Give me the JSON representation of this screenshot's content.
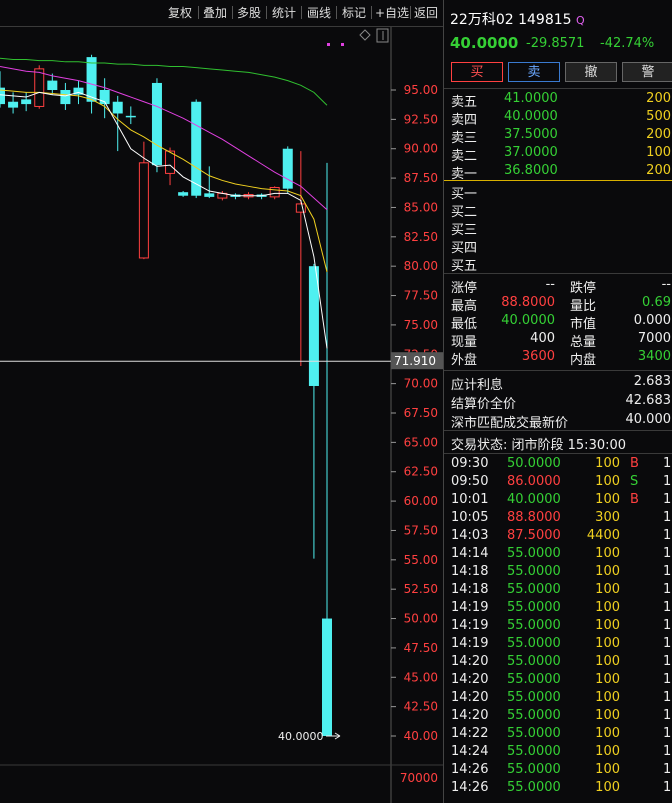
{
  "toolbar": {
    "items": [
      "复权",
      "叠加",
      "多股",
      "统计",
      "画线",
      "标记",
      "+自选",
      "返回"
    ]
  },
  "chart": {
    "y_ticks": [
      "95.00",
      "92.50",
      "90.00",
      "87.50",
      "85.00",
      "82.50",
      "80.00",
      "77.50",
      "75.00",
      "72.50",
      "70.00",
      "67.50",
      "65.00",
      "62.50",
      "60.00",
      "57.50",
      "55.00",
      "52.50",
      "50.00",
      "47.50",
      "45.00",
      "42.50",
      "40.00"
    ],
    "y_values": [
      95,
      92.5,
      90,
      87.5,
      85,
      82.5,
      80,
      77.5,
      75,
      72.5,
      70,
      67.5,
      65,
      62.5,
      60,
      57.5,
      55,
      52.5,
      50,
      47.5,
      45,
      42.5,
      40
    ],
    "crosshair_label": "71.910",
    "crosshair_value": 71.91,
    "low_marker_label": "40.0000",
    "volume_label": "70000",
    "colors": {
      "up": "#ff4040",
      "down": "#4ff0f0",
      "ma5": "#ffffff",
      "ma10": "#f0d020",
      "ma20": "#e040e0",
      "ma60": "#30c030"
    }
  },
  "quote": {
    "name": "22万科02",
    "code": "149815",
    "q_icon": "Q",
    "last": "40.0000",
    "change": "-29.8571",
    "change_pct": "-42.74%",
    "buttons": [
      "买",
      "卖",
      "撤",
      "警"
    ]
  },
  "sell_book": [
    {
      "label": "卖五",
      "price": "41.0000",
      "vol": "200"
    },
    {
      "label": "卖四",
      "price": "40.0000",
      "vol": "500"
    },
    {
      "label": "卖三",
      "price": "37.5000",
      "vol": "200"
    },
    {
      "label": "卖二",
      "price": "37.0000",
      "vol": "100"
    },
    {
      "label": "卖一",
      "price": "36.8000",
      "vol": "200"
    }
  ],
  "buy_book": [
    {
      "label": "买一"
    },
    {
      "label": "买二"
    },
    {
      "label": "买三"
    },
    {
      "label": "买四"
    },
    {
      "label": "买五"
    }
  ],
  "stats": [
    {
      "l1": "涨停",
      "v1": "--",
      "c1": "white",
      "l2": "跌停",
      "v2": "--",
      "c2": "white"
    },
    {
      "l1": "最高",
      "v1": "88.8000",
      "c1": "red",
      "l2": "量比",
      "v2": "0.69",
      "c2": "green"
    },
    {
      "l1": "最低",
      "v1": "40.0000",
      "c1": "green",
      "l2": "市值",
      "v2": "0.000",
      "c2": "white"
    },
    {
      "l1": "现量",
      "v1": "400",
      "c1": "white",
      "l2": "总量",
      "v2": "7000",
      "c2": "white"
    },
    {
      "l1": "外盘",
      "v1": "3600",
      "c1": "red",
      "l2": "内盘",
      "v2": "3400",
      "c2": "green"
    }
  ],
  "extra": [
    {
      "label": "应计利息",
      "value": "2.683"
    },
    {
      "label": "结算价全价",
      "value": "42.683"
    },
    {
      "label": "深市匹配成交最新价",
      "value": "40.000"
    }
  ],
  "trade_status": "交易状态: 闭市阶段 15:30:00",
  "ticks": [
    {
      "time": "09:30",
      "price": "50.0000",
      "pc": "green",
      "vol": "100",
      "flag": "B",
      "n": "1"
    },
    {
      "time": "09:50",
      "price": "86.0000",
      "pc": "red",
      "vol": "100",
      "flag": "S",
      "n": "1"
    },
    {
      "time": "10:01",
      "price": "40.0000",
      "pc": "green",
      "vol": "100",
      "flag": "B",
      "n": "1"
    },
    {
      "time": "10:05",
      "price": "88.8000",
      "pc": "red",
      "vol": "300",
      "flag": "",
      "n": "1"
    },
    {
      "time": "14:03",
      "price": "87.5000",
      "pc": "red",
      "vol": "4400",
      "flag": "",
      "n": "1"
    },
    {
      "time": "14:14",
      "price": "55.0000",
      "pc": "green",
      "vol": "100",
      "flag": "",
      "n": "1"
    },
    {
      "time": "14:18",
      "price": "55.0000",
      "pc": "green",
      "vol": "100",
      "flag": "",
      "n": "1"
    },
    {
      "time": "14:18",
      "price": "55.0000",
      "pc": "green",
      "vol": "100",
      "flag": "",
      "n": "1"
    },
    {
      "time": "14:19",
      "price": "55.0000",
      "pc": "green",
      "vol": "100",
      "flag": "",
      "n": "1"
    },
    {
      "time": "14:19",
      "price": "55.0000",
      "pc": "green",
      "vol": "100",
      "flag": "",
      "n": "1"
    },
    {
      "time": "14:19",
      "price": "55.0000",
      "pc": "green",
      "vol": "100",
      "flag": "",
      "n": "1"
    },
    {
      "time": "14:20",
      "price": "55.0000",
      "pc": "green",
      "vol": "100",
      "flag": "",
      "n": "1"
    },
    {
      "time": "14:20",
      "price": "55.0000",
      "pc": "green",
      "vol": "100",
      "flag": "",
      "n": "1"
    },
    {
      "time": "14:20",
      "price": "55.0000",
      "pc": "green",
      "vol": "100",
      "flag": "",
      "n": "1"
    },
    {
      "time": "14:20",
      "price": "55.0000",
      "pc": "green",
      "vol": "100",
      "flag": "",
      "n": "1"
    },
    {
      "time": "14:22",
      "price": "55.0000",
      "pc": "green",
      "vol": "100",
      "flag": "",
      "n": "1"
    },
    {
      "time": "14:24",
      "price": "55.0000",
      "pc": "green",
      "vol": "100",
      "flag": "",
      "n": "1"
    },
    {
      "time": "14:26",
      "price": "55.0000",
      "pc": "green",
      "vol": "100",
      "flag": "",
      "n": "1"
    },
    {
      "time": "14:26",
      "price": "55.0000",
      "pc": "green",
      "vol": "100",
      "flag": "",
      "n": "1"
    }
  ],
  "chart_data": {
    "type": "candlestick",
    "title": "",
    "ylim": [
      38,
      99
    ],
    "y_ticks": [
      95,
      92.5,
      90,
      87.5,
      85,
      82.5,
      80,
      77.5,
      75,
      72.5,
      70,
      67.5,
      65,
      62.5,
      60,
      57.5,
      55,
      52.5,
      50,
      47.5,
      45,
      42.5,
      40
    ],
    "candles": [
      {
        "open": 95.2,
        "close": 93.8,
        "high": 96.6,
        "low": 93.5
      },
      {
        "open": 94.0,
        "close": 93.5,
        "high": 94.8,
        "low": 93.0
      },
      {
        "open": 94.2,
        "close": 93.8,
        "high": 94.8,
        "low": 93.2
      },
      {
        "open": 93.6,
        "close": 96.8,
        "high": 97.1,
        "low": 93.4
      },
      {
        "open": 95.8,
        "close": 95.0,
        "high": 96.4,
        "low": 94.6
      },
      {
        "open": 95.0,
        "close": 93.8,
        "high": 95.6,
        "low": 93.3
      },
      {
        "open": 95.2,
        "close": 94.6,
        "high": 95.8,
        "low": 93.8
      },
      {
        "open": 97.8,
        "close": 94.0,
        "high": 98.0,
        "low": 93.0
      },
      {
        "open": 95.0,
        "close": 93.8,
        "high": 96.0,
        "low": 92.6
      },
      {
        "open": 94.0,
        "close": 93.0,
        "high": 94.5,
        "low": 89.8
      },
      {
        "open": 92.8,
        "close": 92.7,
        "high": 93.6,
        "low": 92.1
      },
      {
        "open": 80.7,
        "close": 88.8,
        "high": 90.6,
        "low": 80.6
      },
      {
        "open": 95.6,
        "close": 88.6,
        "high": 96.0,
        "low": 88.0
      },
      {
        "open": 87.9,
        "close": 89.8,
        "high": 90.1,
        "low": 86.9
      },
      {
        "open": 86.3,
        "close": 86.0,
        "high": 86.4,
        "low": 85.9
      },
      {
        "open": 94.0,
        "close": 86.0,
        "high": 94.2,
        "low": 85.8
      },
      {
        "open": 86.2,
        "close": 85.9,
        "high": 88.5,
        "low": 85.8
      },
      {
        "open": 85.8,
        "close": 86.2,
        "high": 86.4,
        "low": 85.6
      },
      {
        "open": 86.1,
        "close": 85.9,
        "high": 86.2,
        "low": 85.7
      },
      {
        "open": 85.9,
        "close": 86.1,
        "high": 86.3,
        "low": 85.7
      },
      {
        "open": 86.1,
        "close": 85.9,
        "high": 86.2,
        "low": 85.7
      },
      {
        "open": 85.9,
        "close": 86.7,
        "high": 86.8,
        "low": 85.7
      },
      {
        "open": 90.0,
        "close": 86.6,
        "high": 90.2,
        "low": 86.2
      },
      {
        "open": 84.6,
        "close": 85.3,
        "high": 89.8,
        "low": 71.5
      },
      {
        "open": 80.0,
        "close": 69.8,
        "high": 80.2,
        "low": 55.1
      },
      {
        "open": 50.0,
        "close": 40.0,
        "high": 88.8,
        "low": 40.0
      }
    ],
    "ma": {
      "ma5": [
        94.6,
        94.5,
        94.4,
        94.8,
        94.6,
        94.5,
        94.8,
        94.4,
        94.0,
        92.0,
        90.0,
        89.2,
        88.5,
        88.6,
        87.6,
        87.0,
        86.4,
        86.2,
        86.0,
        86.0,
        86.0,
        86.2,
        86.2,
        85.6,
        80.8,
        73.0
      ],
      "ma10": [
        95.0,
        94.9,
        94.8,
        94.8,
        94.7,
        94.6,
        94.5,
        94.2,
        93.6,
        92.5,
        91.6,
        91.0,
        90.3,
        89.7,
        89.1,
        88.4,
        87.7,
        87.3,
        87.0,
        86.8,
        86.6,
        86.5,
        86.4,
        86.0,
        84.0,
        79.5
      ],
      "ma20": [
        97.0,
        96.8,
        96.6,
        96.5,
        96.2,
        96.0,
        95.8,
        95.5,
        95.2,
        94.8,
        94.4,
        94.0,
        93.6,
        93.1,
        92.6,
        92.0,
        91.4,
        90.8,
        90.1,
        89.4,
        88.7,
        88.0,
        87.4,
        86.8,
        85.8,
        84.8
      ],
      "ma60": [
        97.7,
        97.6,
        97.6,
        97.5,
        97.5,
        97.4,
        97.4,
        97.3,
        97.3,
        97.2,
        97.2,
        97.1,
        97.1,
        97.0,
        97.0,
        96.9,
        96.8,
        96.7,
        96.6,
        96.5,
        96.3,
        96.1,
        95.8,
        95.4,
        94.8,
        93.7
      ]
    }
  }
}
